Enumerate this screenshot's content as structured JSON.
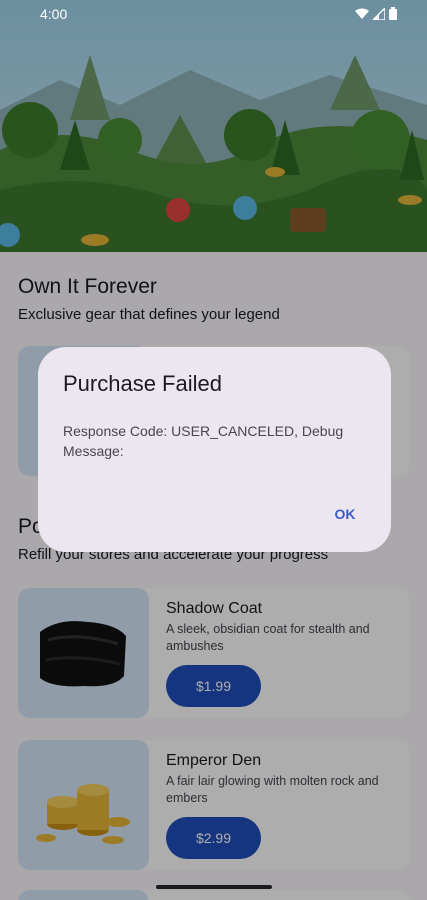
{
  "status": {
    "time": "4:00"
  },
  "sections": {
    "own": {
      "title": "Own It Forever",
      "subtitle": "Exclusive gear that defines your legend"
    },
    "power": {
      "title_partial": "Po",
      "subtitle": "Refill your stores and accelerate your progress"
    }
  },
  "products": [
    {
      "name": "Shadow Coat",
      "description": "A sleek, obsidian coat for stealth and ambushes",
      "price": "$1.99",
      "image_icon": "coat-icon"
    },
    {
      "name": "Emperor Den",
      "description": "A fair lair glowing with molten rock and embers",
      "price": "$2.99",
      "image_icon": "gold-coins-icon"
    }
  ],
  "dialog": {
    "title": "Purchase Failed",
    "message": "Response Code: USER_CANCELED, Debug Message:",
    "ok_label": "OK"
  },
  "colors": {
    "accent": "#1f4fbf",
    "dialog_bg": "#ece6f0",
    "card_image_bg": "#d5e6f6"
  }
}
